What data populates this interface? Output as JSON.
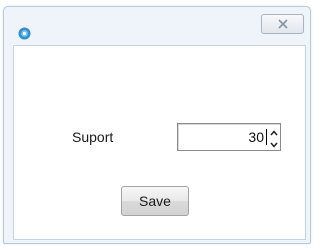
{
  "window": {
    "app_icon": "app-logo-icon",
    "close_icon": "close-icon"
  },
  "form": {
    "field_label": "Suport",
    "spinner_value": "30",
    "spinner_up_icon": "chevron-up-icon",
    "spinner_down_icon": "chevron-down-icon"
  },
  "buttons": {
    "save_label": "Save"
  },
  "colors": {
    "window_frame": "#eef4f9",
    "client_bg": "#ffffff",
    "app_icon": "#2e8fd4"
  }
}
